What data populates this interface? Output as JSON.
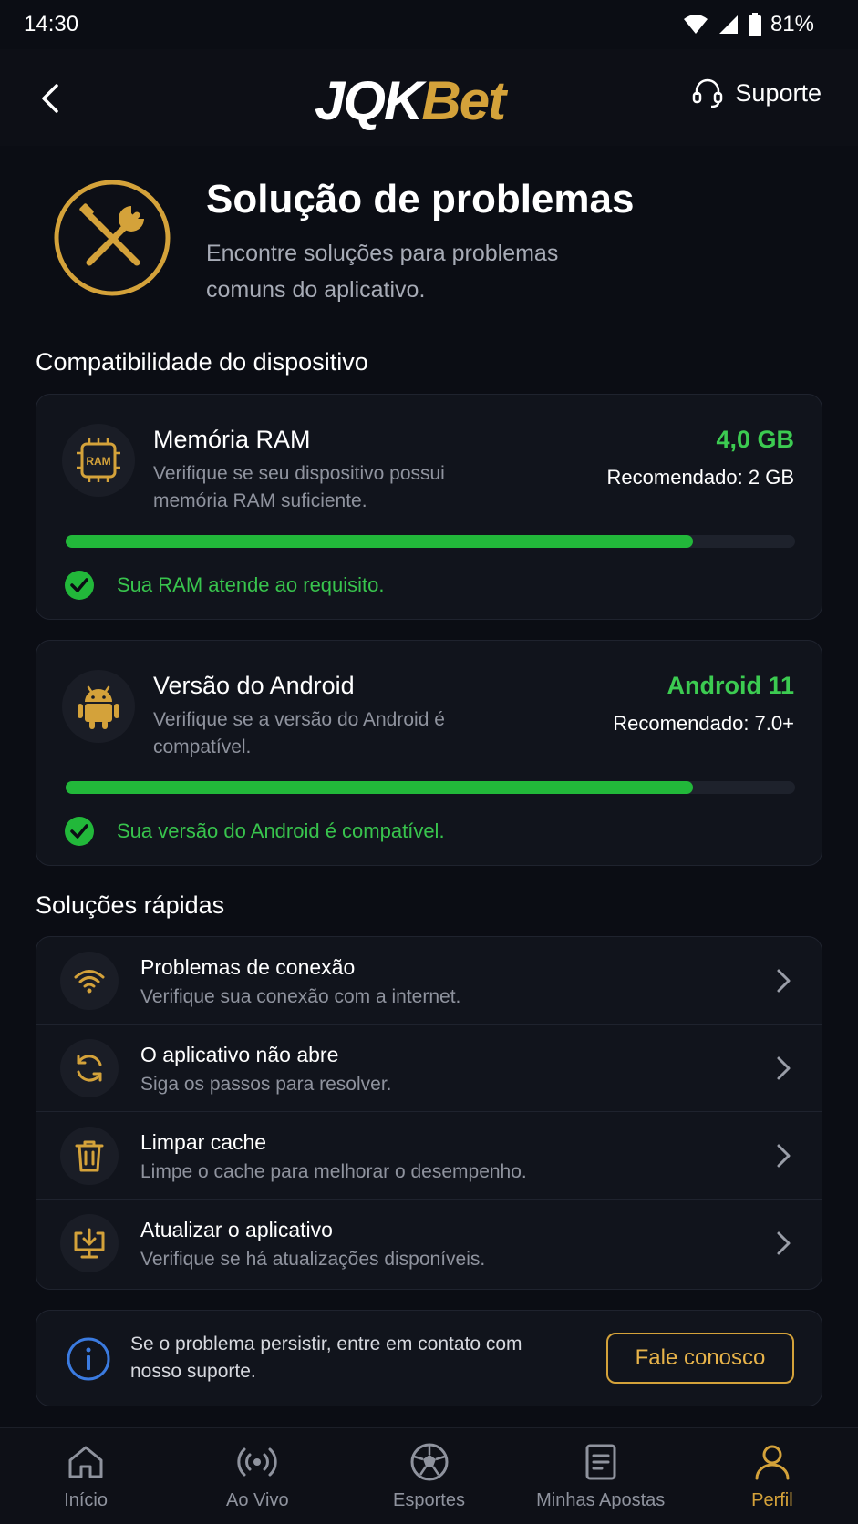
{
  "status_bar": {
    "time": "14:30",
    "battery": "81%"
  },
  "header": {
    "logo_part1": "JQK",
    "logo_part2": "Bet",
    "support_label": "Suporte"
  },
  "hero": {
    "title": "Solução de problemas",
    "subtitle": "Encontre soluções para problemas comuns do aplicativo."
  },
  "compat": {
    "section_title": "Compatibilidade do dispositivo",
    "ram": {
      "title": "Memória RAM",
      "description": "Verifique se seu dispositivo possui memória RAM suficiente.",
      "value": "4,0 GB",
      "recommended": "Recomendado: 2 GB",
      "icon_text": "RAM",
      "progress": 0.86,
      "status": "Sua RAM atende ao requisito."
    },
    "android": {
      "title": "Versão do Android",
      "description": "Verifique se a versão do Android é compatível.",
      "value": "Android 11",
      "recommended": "Recomendado: 7.0+",
      "progress": 0.86,
      "status": "Sua versão do Android é compatível."
    }
  },
  "quick": {
    "section_title": "Soluções rápidas",
    "items": [
      {
        "title": "Problemas de conexão",
        "description": "Verifique sua conexão com a internet.",
        "icon": "wifi-icon"
      },
      {
        "title": "O aplicativo não abre",
        "description": "Siga os passos para resolver.",
        "icon": "refresh-icon"
      },
      {
        "title": "Limpar cache",
        "description": "Limpe o cache para melhorar o desempenho.",
        "icon": "trash-icon"
      },
      {
        "title": "Atualizar o aplicativo",
        "description": "Verifique se há atualizações disponíveis.",
        "icon": "update-icon"
      }
    ]
  },
  "help": {
    "text": "Se o problema persistir, entre em contato com nosso suporte.",
    "button": "Fale conosco"
  },
  "nav": {
    "items": [
      {
        "label": "Início",
        "icon": "home-icon"
      },
      {
        "label": "Ao Vivo",
        "icon": "live-icon"
      },
      {
        "label": "Esportes",
        "icon": "soccer-ball-icon"
      },
      {
        "label": "Minhas Apostas",
        "icon": "bets-icon"
      },
      {
        "label": "Perfil",
        "icon": "profile-icon",
        "active": true
      }
    ]
  },
  "colors": {
    "accent": "#d4a23a",
    "success": "#22b83a",
    "background": "#0b0d14",
    "card": "#11141c",
    "info": "#3b7be0"
  }
}
